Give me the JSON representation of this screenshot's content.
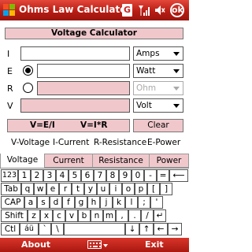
{
  "titlebar": {
    "title": "Ohms Law Calculator",
    "g_label": "G",
    "ok_label": "ok",
    "colors": {
      "bar": "#c0221a",
      "text": "#ffffff"
    }
  },
  "calculator": {
    "title": "Voltage Calculator",
    "rows": [
      {
        "label": "I",
        "value": "",
        "unit": "Amps"
      },
      {
        "label": "E",
        "value": "",
        "unit": "Watt",
        "selected": true
      },
      {
        "label": "R",
        "value": "",
        "unit": "Ohm",
        "selected": false
      },
      {
        "label": "V",
        "value": "",
        "unit": "Volt"
      }
    ],
    "formula1": "V=E/I",
    "formula2": "V=I*R",
    "clear_label": "Clear",
    "legend": [
      "V-Voltage",
      "I-Current",
      "R-Resistance",
      "E-Power"
    ],
    "colors": {
      "pink": "#f0c8cc"
    }
  },
  "tabs": [
    "Voltage",
    "Current",
    "Resistance",
    "Power"
  ],
  "active_tab": "Voltage",
  "keyboard": {
    "row1": [
      "123",
      "1",
      "2",
      "3",
      "4",
      "5",
      "6",
      "7",
      "8",
      "9",
      "0",
      "-",
      "=",
      "⟵"
    ],
    "row2": [
      "Tab",
      "q",
      "w",
      "e",
      "r",
      "t",
      "y",
      "u",
      "i",
      "o",
      "p",
      "[",
      "]"
    ],
    "row3": [
      "CAP",
      "a",
      "s",
      "d",
      "f",
      "g",
      "h",
      "j",
      "k",
      "l",
      ";",
      "'"
    ],
    "row4": [
      "Shift",
      "z",
      "x",
      "c",
      "v",
      "b",
      "n",
      "m",
      ",",
      ".",
      "/",
      "↵"
    ],
    "row5": [
      "Ctl",
      "áü",
      "`",
      "\\",
      "",
      "↓",
      "↑",
      "←",
      "→"
    ]
  },
  "bottombar": {
    "left": "About",
    "right": "Exit"
  }
}
